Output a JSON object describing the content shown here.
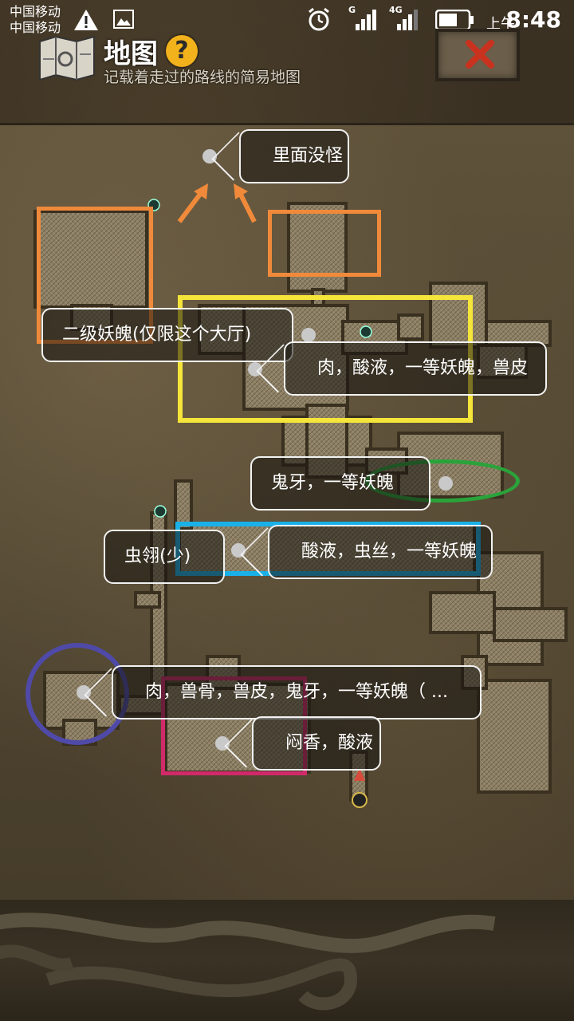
{
  "status_bar": {
    "carrier_1": "中国移动",
    "carrier_2": "中国移动",
    "ampm": "上午",
    "time": "8:48",
    "network_1": "G",
    "network_2": "4G"
  },
  "header": {
    "title": "地图",
    "help_label": "?",
    "subtitle": "记载着走过的路线的简易地图"
  },
  "callouts": {
    "no_monsters": "里面没怪",
    "level2_hall": "二级妖魄(仅限这个大厅)",
    "drop_meat_acid": "肉，酸液，一等妖魄，兽皮",
    "drop_fang": "鬼牙，一等妖魄",
    "drop_wing": "虫翎(少)",
    "drop_acid_silk": "酸液，虫丝，一等妖魄",
    "drop_meat_bone": "肉，兽骨，兽皮，鬼牙，一等妖魄（ ...",
    "drop_incense": "闷香，酸液"
  },
  "annotation_colors": {
    "orange": "#f08a3a",
    "yellow": "#f5e53a",
    "green": "#2aa33a",
    "blue": "#1ab0e8",
    "purple": "#4f4aa8",
    "magenta": "#d12a6a"
  }
}
